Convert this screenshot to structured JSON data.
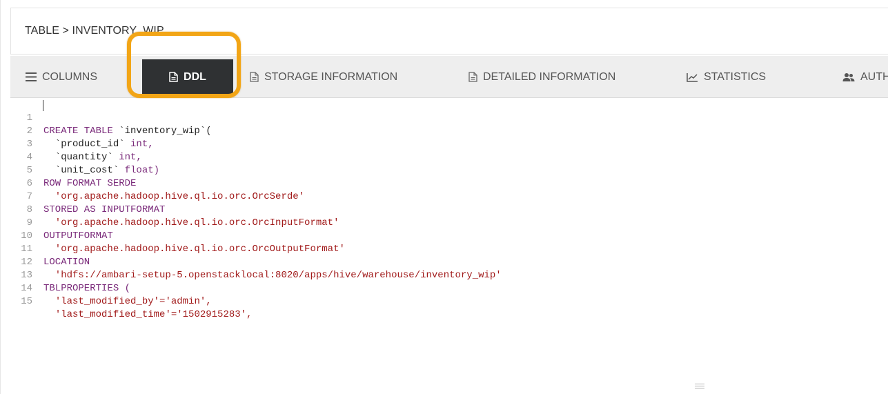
{
  "breadcrumb": "TABLE > INVENTORY_WIP",
  "tabs": {
    "columns": "COLUMNS",
    "ddl": "DDL",
    "storage": "STORAGE INFORMATION",
    "detailed": "DETAILED INFORMATION",
    "statistics": "STATISTICS",
    "authorization": "AUTHO"
  },
  "icons": {
    "columns": "list-icon",
    "ddl": "document-icon",
    "storage": "document-icon",
    "detailed": "document-icon",
    "statistics": "line-chart-icon",
    "authorization": "users-icon"
  },
  "colors": {
    "highlight": "#f2a516",
    "active_tab": "#2f3133",
    "keyword": "#7a2a7a",
    "string": "#a11a1a"
  },
  "ddl_lines": [
    {
      "n": "1",
      "kw": "CREATE TABLE ",
      "id": "`inventory_wip`(",
      "kw2": "",
      "str": ""
    },
    {
      "n": "2",
      "kw": "",
      "id": "  `product_id` ",
      "kw2": "int,",
      "str": ""
    },
    {
      "n": "3",
      "kw": "",
      "id": "  `quantity` ",
      "kw2": "int,",
      "str": ""
    },
    {
      "n": "4",
      "kw": "",
      "id": "  `unit_cost` ",
      "kw2": "float)",
      "str": ""
    },
    {
      "n": "5",
      "kw": "ROW FORMAT SERDE",
      "id": "",
      "kw2": "",
      "str": ""
    },
    {
      "n": "6",
      "kw": "",
      "id": "",
      "kw2": "",
      "str": "  'org.apache.hadoop.hive.ql.io.orc.OrcSerde'"
    },
    {
      "n": "7",
      "kw": "STORED AS INPUTFORMAT",
      "id": "",
      "kw2": "",
      "str": ""
    },
    {
      "n": "8",
      "kw": "",
      "id": "",
      "kw2": "",
      "str": "  'org.apache.hadoop.hive.ql.io.orc.OrcInputFormat'"
    },
    {
      "n": "9",
      "kw": "OUTPUTFORMAT",
      "id": "",
      "kw2": "",
      "str": ""
    },
    {
      "n": "10",
      "kw": "",
      "id": "",
      "kw2": "",
      "str": "  'org.apache.hadoop.hive.ql.io.orc.OrcOutputFormat'"
    },
    {
      "n": "11",
      "kw": "LOCATION",
      "id": "",
      "kw2": "",
      "str": ""
    },
    {
      "n": "12",
      "kw": "",
      "id": "",
      "kw2": "",
      "str": "  'hdfs://ambari-setup-5.openstacklocal:8020/apps/hive/warehouse/inventory_wip'"
    },
    {
      "n": "13",
      "kw": "TBLPROPERTIES (",
      "id": "",
      "kw2": "",
      "str": ""
    },
    {
      "n": "14",
      "kw": "",
      "id": "  ",
      "kw2": "",
      "str": "'last_modified_by'='admin',",
      "trail": ""
    },
    {
      "n": "15",
      "kw": "",
      "id": "  ",
      "kw2": "",
      "str": "'last_modified_time'='1502915283',",
      "trail": ""
    }
  ]
}
